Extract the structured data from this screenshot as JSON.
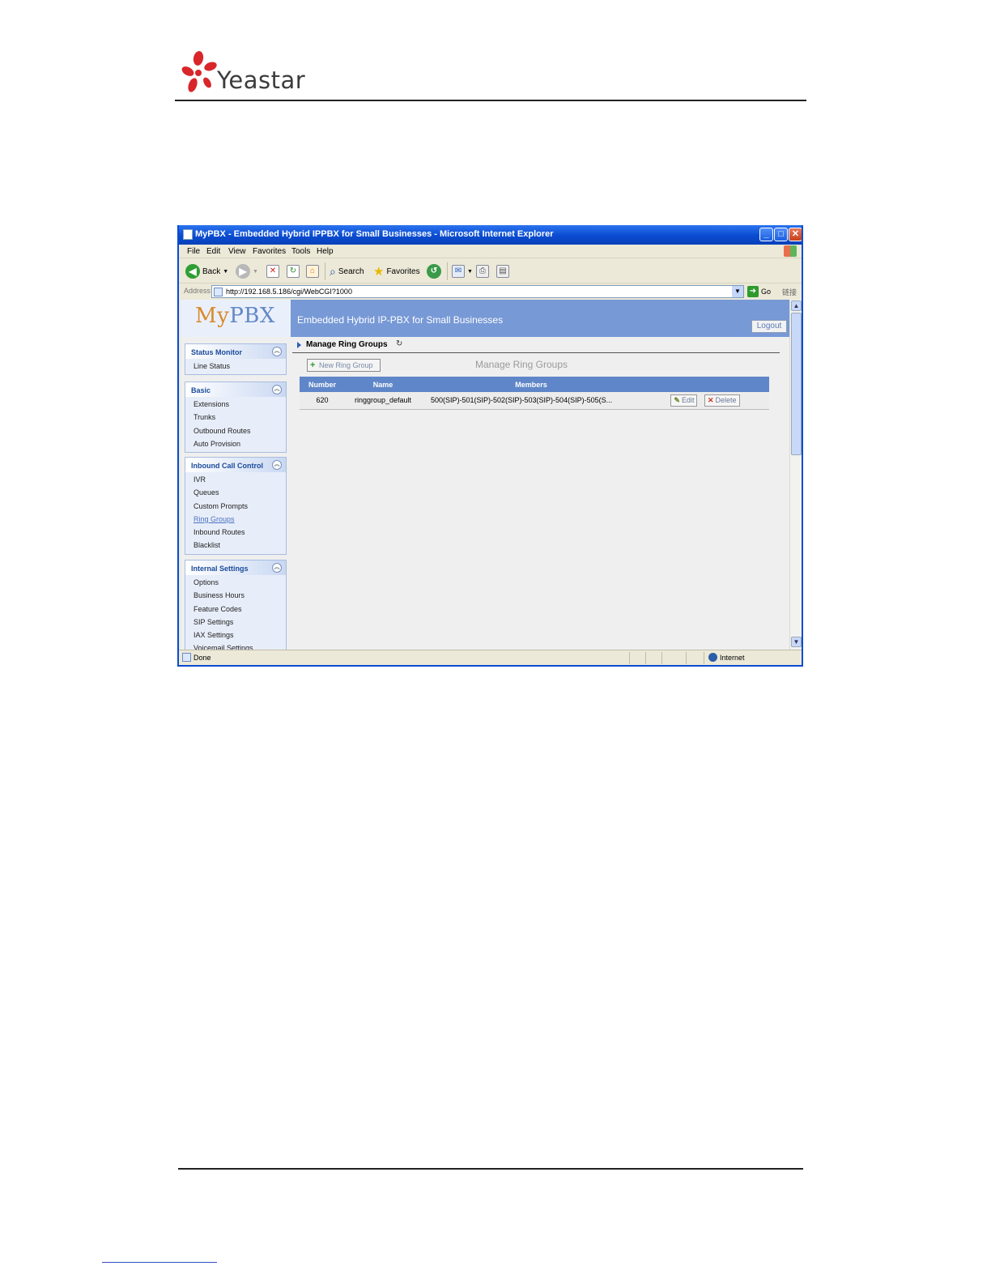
{
  "doc": {
    "logo_text": "Yeastar"
  },
  "window": {
    "title": "MyPBX - Embedded Hybrid IPPBX for Small Businesses - Microsoft Internet Explorer",
    "buttons": {
      "minimize": "_",
      "maximize": "□",
      "close": "✕"
    }
  },
  "menu": [
    "File",
    "Edit",
    "View",
    "Favorites",
    "Tools",
    "Help"
  ],
  "toolbar": {
    "back_label": "Back",
    "search_label": "Search",
    "favorites_label": "Favorites"
  },
  "address": {
    "label": "Address",
    "url": "http://192.168.5.186/cgi/WebCGI?1000",
    "go_label": "Go",
    "links_label": "链接"
  },
  "status": {
    "text": "Done",
    "zone": "Internet"
  },
  "app": {
    "brand_my": "My",
    "brand_pbx": "PBX",
    "slogan": "Embedded Hybrid IP-PBX for Small Businesses",
    "logout_label": "Logout"
  },
  "sidebar": {
    "groups": [
      {
        "title": "Status Monitor",
        "items": [
          "Line Status"
        ]
      },
      {
        "title": "Basic",
        "items": [
          "Extensions",
          "Trunks",
          "Outbound Routes",
          "Auto Provision"
        ]
      },
      {
        "title": "Inbound Call Control",
        "items": [
          "IVR",
          "Queues",
          "Custom Prompts",
          "Ring Groups",
          "Inbound Routes",
          "Blacklist"
        ]
      },
      {
        "title": "Internal Settings",
        "items": [
          "Options",
          "Business Hours",
          "Feature Codes",
          "SIP Settings",
          "IAX Settings",
          "Voicemail Settings"
        ]
      }
    ],
    "active_item": "Ring Groups"
  },
  "main": {
    "breadcrumb": "Manage Ring Groups",
    "heading": "Manage Ring Groups",
    "new_button_label": "New Ring Group",
    "table": {
      "columns": [
        "Number",
        "Name",
        "Members"
      ],
      "rows": [
        {
          "number": "620",
          "name": "ringgroup_default",
          "members": "500(SIP)-501(SIP)-502(SIP)-503(SIP)-504(SIP)-505(S...",
          "edit_label": "Edit",
          "delete_label": "Delete"
        }
      ]
    }
  },
  "colors": {
    "header_blue": "#7799d6",
    "table_header": "#5f86c8",
    "title_bar": "#0a4bd0",
    "brand_orange": "#d98a2a"
  }
}
